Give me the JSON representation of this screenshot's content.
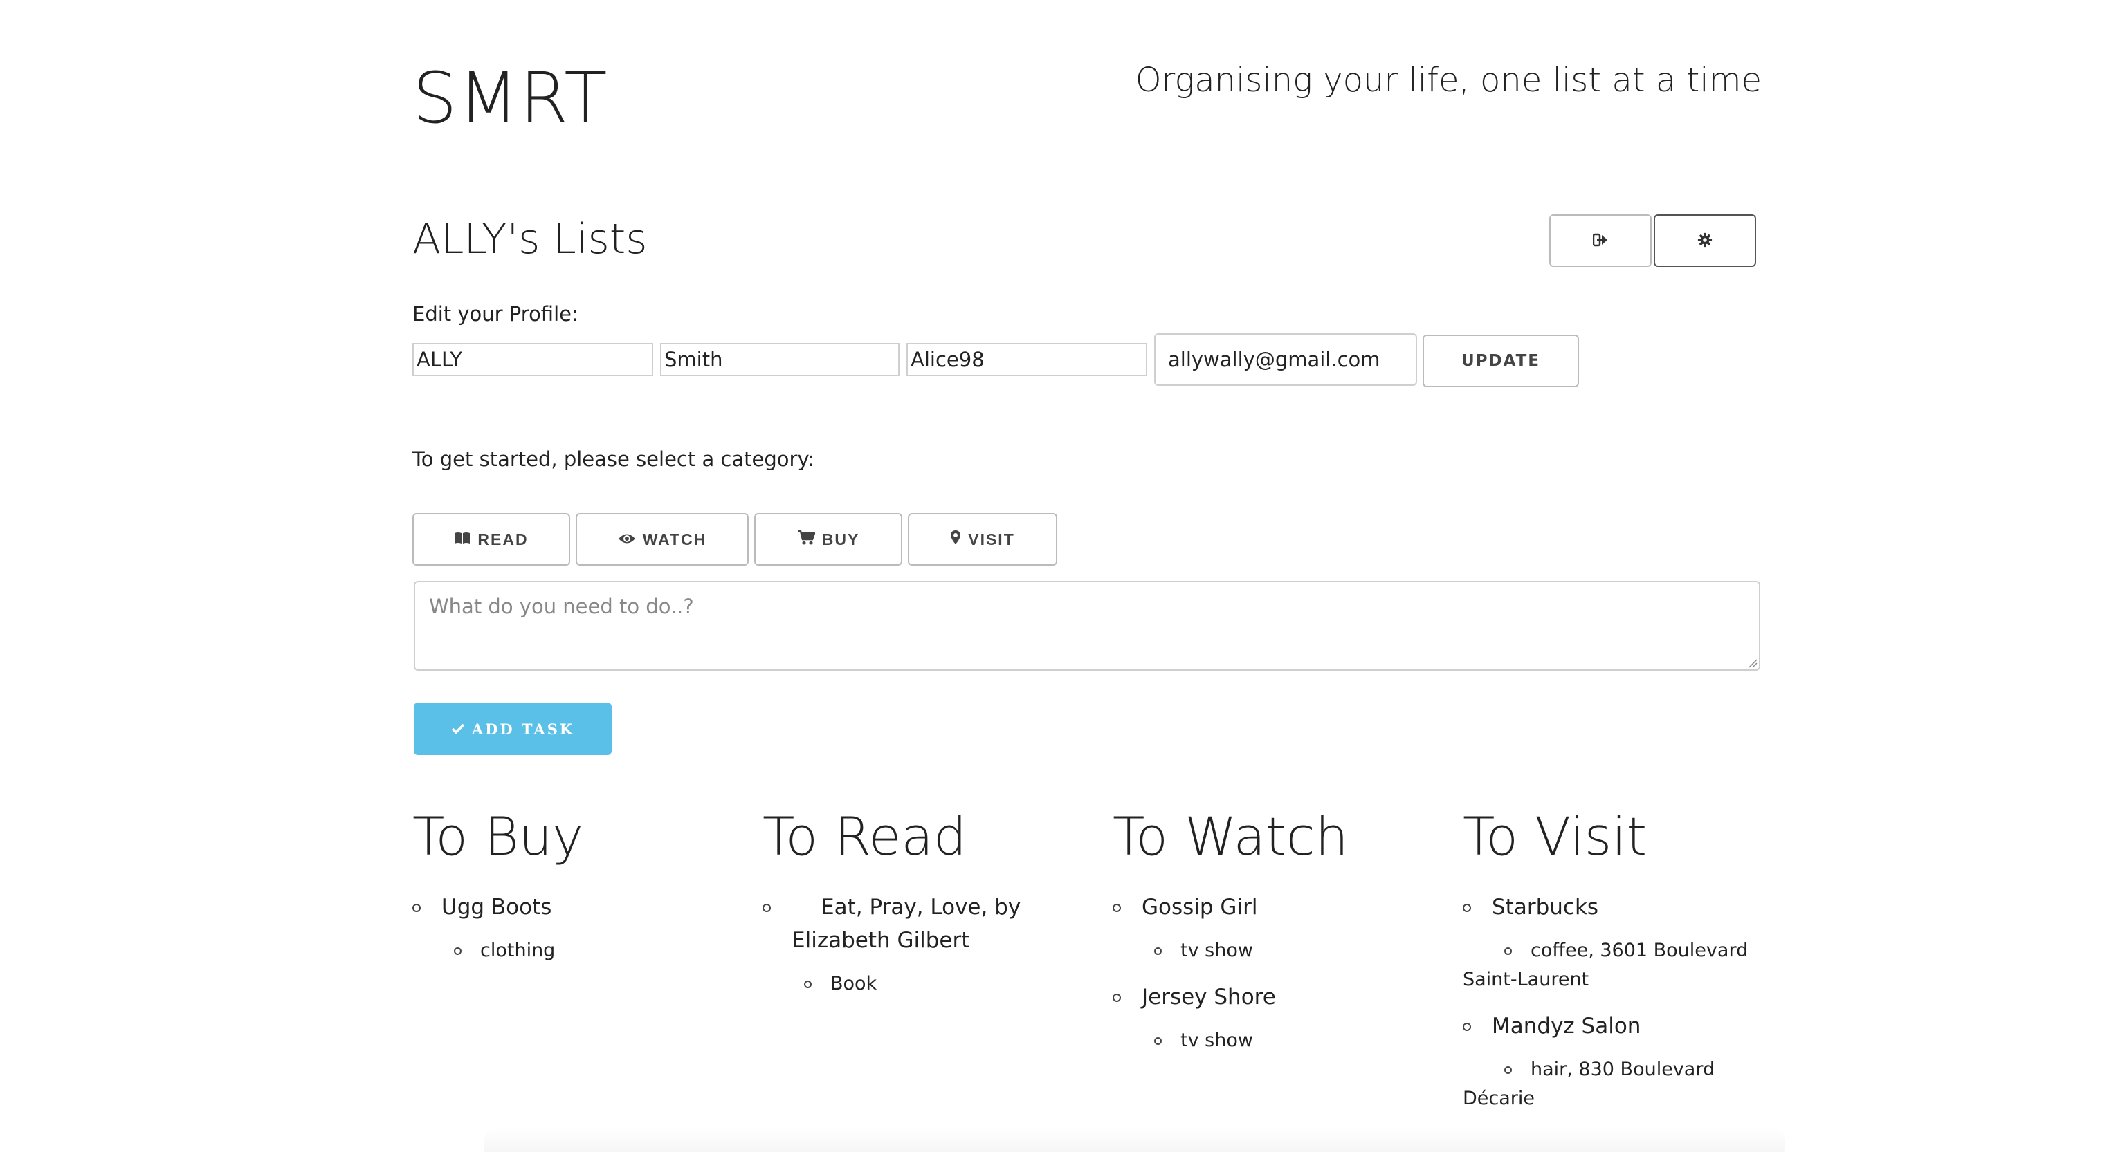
{
  "header": {
    "logo": "SMRT",
    "tagline": "Organising your life, one list at a time"
  },
  "lists_title": "ALLY's Lists",
  "toolbar": {
    "logout_icon": "sign-out-icon",
    "settings_icon": "gear-icon"
  },
  "profile": {
    "label": "Edit your Profile:",
    "first_name": "ALLY",
    "last_name": "Smith",
    "username": "Alice98",
    "email": "allywally@gmail.com",
    "update_label": "UPDATE"
  },
  "category": {
    "prompt": "To get started, please select a category:",
    "buttons": [
      {
        "label": "READ",
        "icon": "book-open-icon"
      },
      {
        "label": "WATCH",
        "icon": "eye-icon"
      },
      {
        "label": "BUY",
        "icon": "shopping-cart-icon"
      },
      {
        "label": "VISIT",
        "icon": "map-marker-icon"
      }
    ]
  },
  "task": {
    "placeholder": "What do you need to do..?",
    "value": "",
    "add_label": "ADD TASK"
  },
  "columns": [
    {
      "title": "To Buy",
      "items": [
        {
          "name": "Ugg Boots",
          "detail": "clothing"
        }
      ]
    },
    {
      "title": "To Read",
      "items": [
        {
          "name": "Eat, Pray, Love, by Elizabeth Gilbert",
          "detail": "Book"
        }
      ]
    },
    {
      "title": "To Watch",
      "items": [
        {
          "name": "Gossip Girl",
          "detail": "tv show"
        },
        {
          "name": "Jersey Shore",
          "detail": "tv show"
        }
      ]
    },
    {
      "title": "To Visit",
      "items": [
        {
          "name": "Starbucks",
          "detail": "coffee, 3601 Boulevard Saint-Laurent"
        },
        {
          "name": "Mandyz Salon",
          "detail": "hair, 830 Boulevard Décarie"
        }
      ]
    }
  ],
  "colors": {
    "accent": "#5bc0e8",
    "border": "#bbbbbb",
    "text": "#222222"
  }
}
